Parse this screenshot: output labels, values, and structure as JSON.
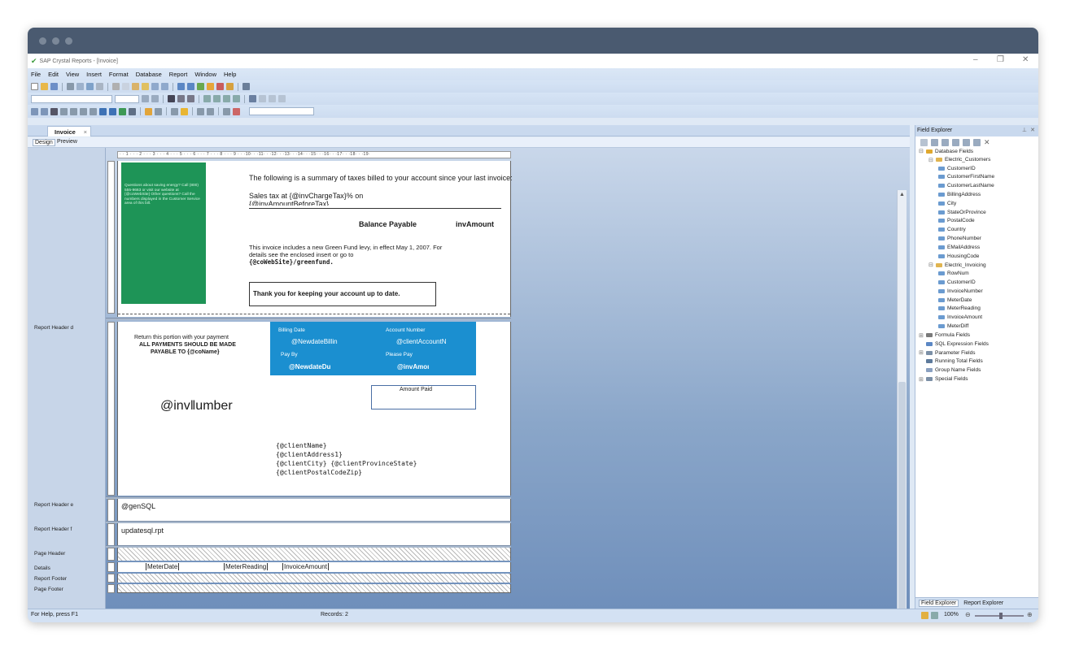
{
  "window": {
    "title": "SAP Crystal Reports - [Invoice]"
  },
  "menu": [
    "File",
    "Edit",
    "View",
    "Insert",
    "Format",
    "Database",
    "Report",
    "Window",
    "Help"
  ],
  "doc_tab": {
    "label": "Invoice",
    "close": "×"
  },
  "view_tabs": {
    "design": "Design",
    "preview": "Preview"
  },
  "sections": {
    "rhd": "Report Header d",
    "rhe": "Report Header e",
    "rhf": "Report Header f",
    "ph": "Page Header",
    "details": "Details",
    "rf": "Report Footer",
    "pf": "Page Footer"
  },
  "ruler_text": "· · 1 · · · 2 · · · 3 · · · 4 · · · 5 · · · 6 · · · 7 · · · 8 · · · 9 · · ·10· · ·11· · ·12· · ·13· · ·14· · ·15· · ·16· · ·17· · ·18· · ·19·",
  "report": {
    "green_box_text": "Questions about saving energy? Call (800) 555-9663 or visit our website at {@coWebSite} Other questions? Call the numbers displayed in the Customer Service area of this bill.",
    "tax_summary": "The following is a summary of taxes billed to your account since your last invoice:",
    "sales_tax": "Sales tax at {@invChargeTax}% on",
    "amount_before_tax": "{@invAmountBeforeTax}",
    "balance_payable": "Balance Payable",
    "inv_amount": "invAmount",
    "green_fund_1": "This invoice includes a new Green Fund levy, in effect May 1, 2007. For",
    "green_fund_2": "details see the enclosed insert or go to",
    "green_fund_3": "{@coWebSite}/greenfund.",
    "thank_you": "Thank you for keeping your account up to date.",
    "return_portion": "Return this portion with your payment",
    "all_payments": "ALL PAYMENTS SHOULD BE MADE",
    "payable_to": "PAYABLE TO {@coName}",
    "billing_date_lbl": "Billing Date",
    "billing_date_val": "@NewdateBillin",
    "account_number_lbl": "Account Number",
    "account_number_val": "@clientAccountN",
    "pay_by_lbl": "Pay By",
    "pay_by_val": "@NewdateDu",
    "please_pay_lbl": "Please Pay",
    "please_pay_val": "@invAmoı",
    "amount_paid": "Amount Paid",
    "inv_number": "@inv‖umber",
    "client_name": "{@clientName}",
    "client_address": "{@clientAddress1}",
    "client_city": "{@clientCity} {@clientProvinceState}",
    "client_postal": "{@clientPostalCodeZip}",
    "gen_sql": "@genSQL",
    "update_sql": "updatesql.rpt",
    "meter_date": "MeterDate",
    "meter_reading": "MeterReading",
    "invoice_amount": "InvoiceAmount"
  },
  "status": {
    "help": "For Help, press F1",
    "records": "Records: 2",
    "zoom": "100%"
  },
  "field_explorer": {
    "title": "Field Explorer",
    "tree": [
      {
        "label": "Database Fields",
        "level": 0,
        "toggle": "⊟",
        "icon": "database"
      },
      {
        "label": "Electric_Customers",
        "level": 1,
        "toggle": "⊟",
        "icon": "table"
      },
      {
        "label": "CustomerID",
        "level": 2,
        "icon": "field"
      },
      {
        "label": "CustomerFirstName",
        "level": 2,
        "icon": "field"
      },
      {
        "label": "CustomerLastName",
        "level": 2,
        "icon": "field"
      },
      {
        "label": "BillingAddress",
        "level": 2,
        "icon": "field"
      },
      {
        "label": "City",
        "level": 2,
        "icon": "field"
      },
      {
        "label": "StateOrProvince",
        "level": 2,
        "icon": "field"
      },
      {
        "label": "PostalCode",
        "level": 2,
        "icon": "field"
      },
      {
        "label": "Country",
        "level": 2,
        "icon": "field"
      },
      {
        "label": "PhoneNumber",
        "level": 2,
        "icon": "field"
      },
      {
        "label": "EMailAddress",
        "level": 2,
        "icon": "field"
      },
      {
        "label": "HousingCode",
        "level": 2,
        "icon": "field"
      },
      {
        "label": "Electric_Invoicing",
        "level": 1,
        "toggle": "⊟",
        "icon": "table"
      },
      {
        "label": "RowNum",
        "level": 2,
        "icon": "field"
      },
      {
        "label": "CustomerID",
        "level": 2,
        "icon": "field"
      },
      {
        "label": "InvoiceNumber",
        "level": 2,
        "icon": "field"
      },
      {
        "label": "MeterDate",
        "level": 2,
        "icon": "field"
      },
      {
        "label": "MeterReading",
        "level": 2,
        "icon": "field"
      },
      {
        "label": "InvoiceAmount",
        "level": 2,
        "icon": "field"
      },
      {
        "label": "MeterDiff",
        "level": 2,
        "icon": "field"
      },
      {
        "label": "Formula Fields",
        "level": 0,
        "toggle": "⊞",
        "icon": "formula"
      },
      {
        "label": "SQL Expression Fields",
        "level": 0,
        "toggle": "",
        "icon": "sql"
      },
      {
        "label": "Parameter Fields",
        "level": 0,
        "toggle": "⊞",
        "icon": "param"
      },
      {
        "label": "Running Total Fields",
        "level": 0,
        "toggle": "",
        "icon": "running"
      },
      {
        "label": "Group Name Fields",
        "level": 0,
        "toggle": "",
        "icon": "group"
      },
      {
        "label": "Special Fields",
        "level": 0,
        "toggle": "⊞",
        "icon": "special"
      }
    ],
    "tab_fe": "Field Explorer",
    "tab_re": "Report Explorer"
  },
  "colors": {
    "green_box": "#1e9457",
    "blue_box": "#1b8fd0",
    "accent": "#2b579a"
  }
}
